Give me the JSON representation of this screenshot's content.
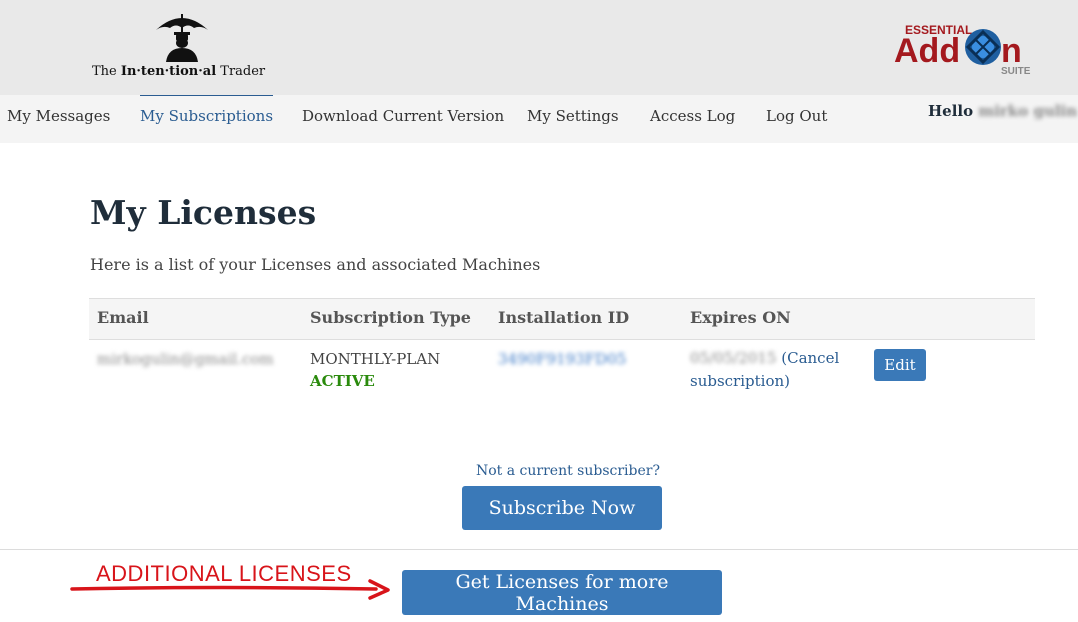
{
  "header": {
    "logo": {
      "text_pre": "The ",
      "text_bold": "In·ten·tion·al",
      "text_post": " Trader",
      "icon": "umbrella-man-icon"
    },
    "addon_logo": {
      "top": "ESSENTIAL",
      "main_a": "Add",
      "main_b": "n",
      "bottom": "SUITE",
      "icon": "blue-gear-o-icon"
    }
  },
  "nav": {
    "items": [
      {
        "label": "My Messages"
      },
      {
        "label": "My Subscriptions",
        "active": true
      },
      {
        "label": "Download Current Version"
      },
      {
        "label": "My Settings"
      },
      {
        "label": "Access Log"
      },
      {
        "label": "Log Out"
      }
    ],
    "hello": "Hello",
    "username": "mirko gulin"
  },
  "main": {
    "title": "My Licenses",
    "subtitle": "Here is a list of your Licenses and associated Machines",
    "table": {
      "headers": [
        "Email",
        "Subscription Type",
        "Installation ID",
        "Expires ON"
      ],
      "rows": [
        {
          "email": "mirkogulin@gmail.com",
          "plan": "MONTHLY-PLAN",
          "status": "ACTIVE",
          "installation_id": "3490F9193FD05",
          "expires": "05/05/2015",
          "cancel_label": "(Cancel subscription)",
          "edit_label": "Edit"
        }
      ]
    },
    "not_subscriber": "Not a current subscriber?",
    "subscribe_label": "Subscribe Now",
    "annotation": "ADDITIONAL LICENSES",
    "more_label": "Get Licenses for more Machines"
  },
  "colors": {
    "accent": "#3a79b8",
    "link": "#2a5c91",
    "active": "#2a8a0c",
    "annotation": "#d8141a",
    "addon_red": "#a4191e"
  }
}
